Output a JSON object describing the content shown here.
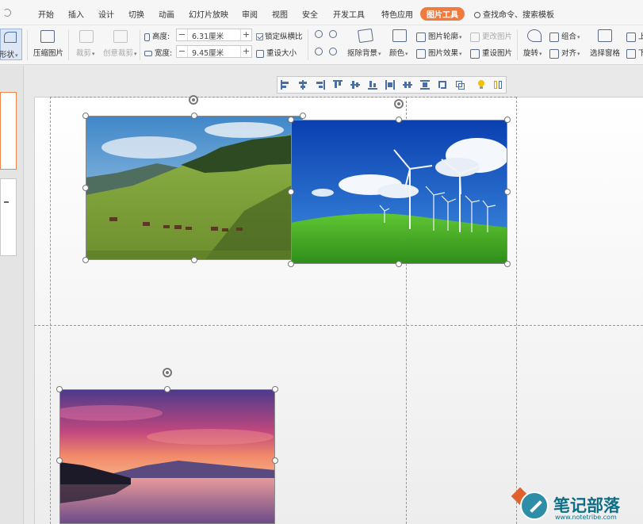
{
  "menubar": {
    "tabs": [
      "开始",
      "插入",
      "设计",
      "切换",
      "动画",
      "幻灯片放映",
      "审阅",
      "视图",
      "安全",
      "开发工具",
      "特色应用",
      "图片工具"
    ],
    "active_tab": "图片工具",
    "search_text": "查找命令、搜索模板"
  },
  "ribbon": {
    "shape_label": "形状",
    "compress_label": "压缩图片",
    "crop_label": "裁剪",
    "creative_crop_label": "创意裁剪",
    "height_label": "高度:",
    "height_value": "6.31厘米",
    "width_label": "宽度:",
    "width_value": "9.45厘米",
    "lock_ratio_label": "锁定纵横比",
    "reset_size_label": "重设大小",
    "remove_bg_label": "抠除背景",
    "color_label": "颜色",
    "outline_label": "图片轮廓",
    "effects_label": "图片效果",
    "change_pic_label": "更改图片",
    "reset_pic_label": "重设图片",
    "rotate_label": "旋转",
    "group_label": "组合",
    "align_label": "对齐",
    "select_pane_label": "选择窗格",
    "up_label": "上",
    "down_label": "下"
  },
  "align_toolbar": {
    "icons": [
      "align-left-icon",
      "align-center-icon",
      "align-right-icon",
      "align-top-icon",
      "align-middle-icon",
      "align-bottom-icon",
      "distribute-horizontal-icon",
      "distribute-vertical-icon",
      "distribute-both-icon",
      "group-icon",
      "crop-icon",
      "tip-icon",
      "more-icon"
    ]
  },
  "images": [
    {
      "name": "hills-cattle-photo"
    },
    {
      "name": "wind-turbines-photo"
    },
    {
      "name": "sunset-lake-photo"
    }
  ],
  "watermark": {
    "title": "笔记部落",
    "url": "www.notetribe.com"
  },
  "colors": {
    "accent": "#f07b3f",
    "icon": "#4a6fa5"
  }
}
